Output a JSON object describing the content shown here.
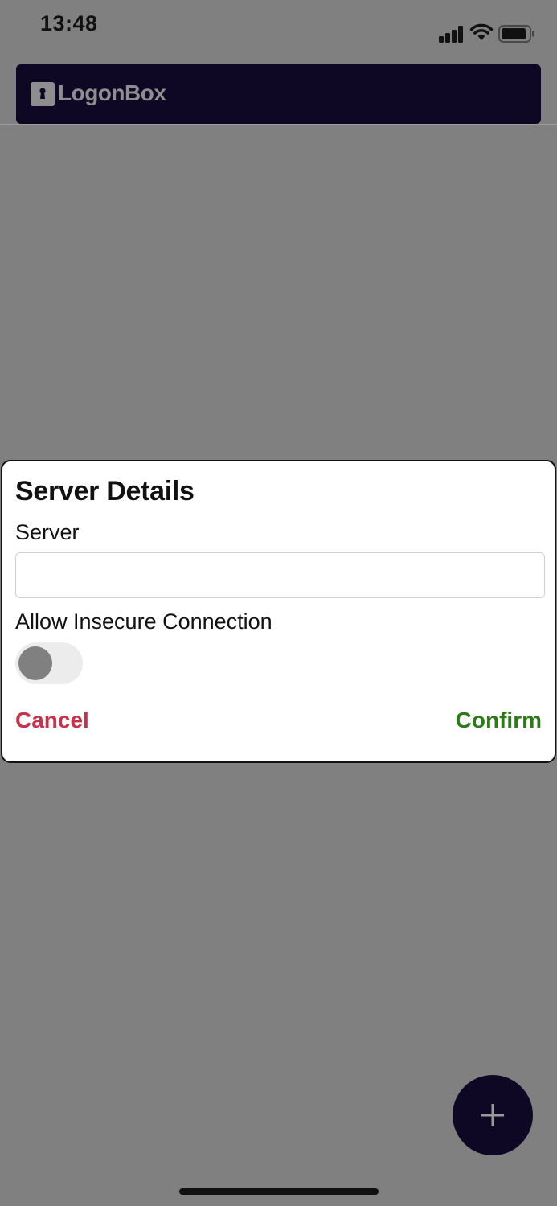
{
  "status_bar": {
    "time": "13:48",
    "icons": [
      "signal-icon",
      "wifi-icon",
      "battery-icon"
    ]
  },
  "header": {
    "logo_text": "LogonBox",
    "logo_icon": "keyhole-icon",
    "background_color": "#0e0825"
  },
  "dialog": {
    "title": "Server Details",
    "server_label": "Server",
    "server_value": "",
    "insecure_label": "Allow Insecure Connection",
    "insecure_enabled": false,
    "cancel_label": "Cancel",
    "confirm_label": "Confirm",
    "cancel_color": "#c8314a",
    "confirm_color": "#2d7a17"
  },
  "fab": {
    "icon": "plus-icon"
  }
}
